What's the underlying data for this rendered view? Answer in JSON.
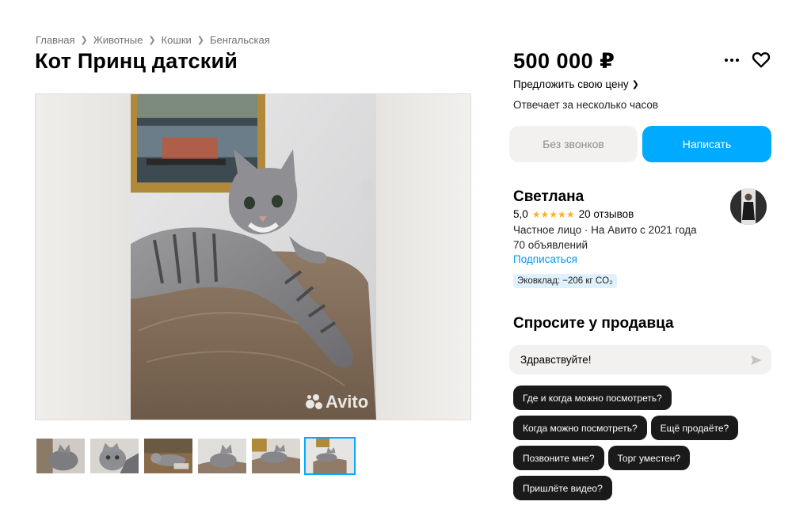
{
  "breadcrumb": [
    "Главная",
    "Животные",
    "Кошки",
    "Бенгальская"
  ],
  "title": "Кот Принц датский",
  "gallery": {
    "watermark": "Avito",
    "thumbnail_count": 6,
    "active_thumbnail": 6
  },
  "price": "500 000 ₽",
  "offer_price_link": "Предложить свою цену",
  "reply_time": "Отвечает за несколько часов",
  "buttons": {
    "no_calls": "Без звонков",
    "write": "Написать"
  },
  "seller": {
    "name": "Светлана",
    "rating": "5,0",
    "stars": 5,
    "reviews": "20 отзывов",
    "type": "Частное лицо · На Авито с 2021 года",
    "ads": "70 объявлений",
    "subscribe": "Подписаться",
    "eco": "Эковклад: −206 кг CO₂"
  },
  "ask": {
    "title": "Спросите у продавца",
    "input_value": "Здравствуйте!",
    "quick_replies": [
      "Где и когда можно посмотреть?",
      "Когда можно посмотреть?",
      "Ещё продаёте?",
      "Позвоните мне?",
      "Торг уместен?",
      "Пришлёте видео?"
    ]
  },
  "colors": {
    "accent": "#00aaff",
    "link": "#0099f7",
    "star": "#ffb021",
    "chip": "#1a1a1a"
  }
}
